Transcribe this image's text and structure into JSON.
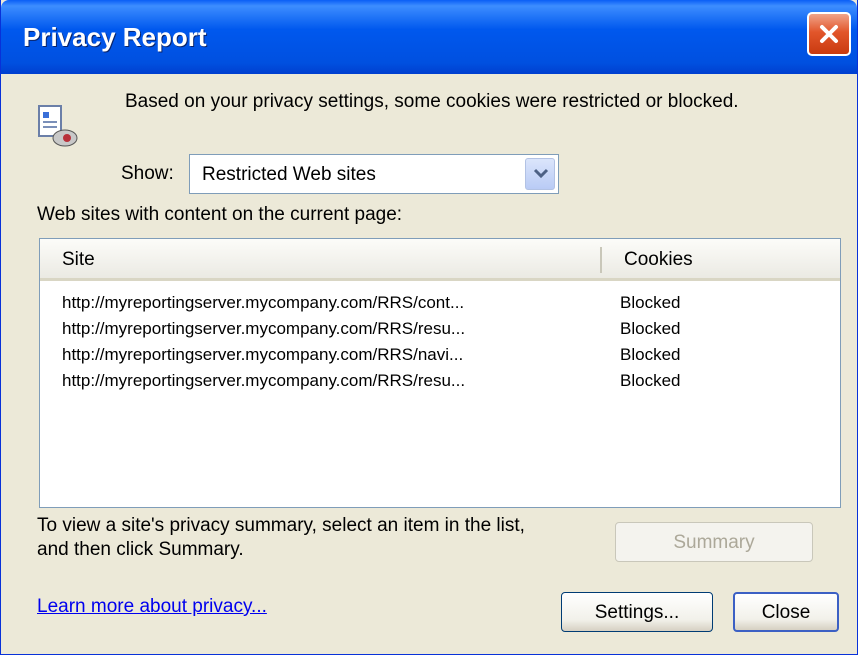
{
  "window": {
    "title": "Privacy Report"
  },
  "icons": {
    "privacy": "privacy-report-icon",
    "close": "close-icon",
    "dropdown": "chevron-down-icon"
  },
  "intro_text": "Based on your privacy settings, some cookies were restricted or blocked.",
  "show": {
    "label": "Show:",
    "selected": "Restricted Web sites"
  },
  "list_caption": "Web sites with content on the current page:",
  "table": {
    "columns": [
      "Site",
      "Cookies"
    ],
    "rows": [
      {
        "site": "http://myreportingserver.mycompany.com/RRS/cont...",
        "cookies": "Blocked"
      },
      {
        "site": "http://myreportingserver.mycompany.com/RRS/resu...",
        "cookies": "Blocked"
      },
      {
        "site": "http://myreportingserver.mycompany.com/RRS/navi...",
        "cookies": "Blocked"
      },
      {
        "site": "http://myreportingserver.mycompany.com/RRS/resu...",
        "cookies": "Blocked"
      }
    ]
  },
  "help": {
    "line1": "To view a site's privacy summary, select an item in the list,",
    "line2": "and then click Summary."
  },
  "buttons": {
    "summary": "Summary",
    "settings": "Settings...",
    "close": "Close"
  },
  "link": "Learn more about privacy..."
}
